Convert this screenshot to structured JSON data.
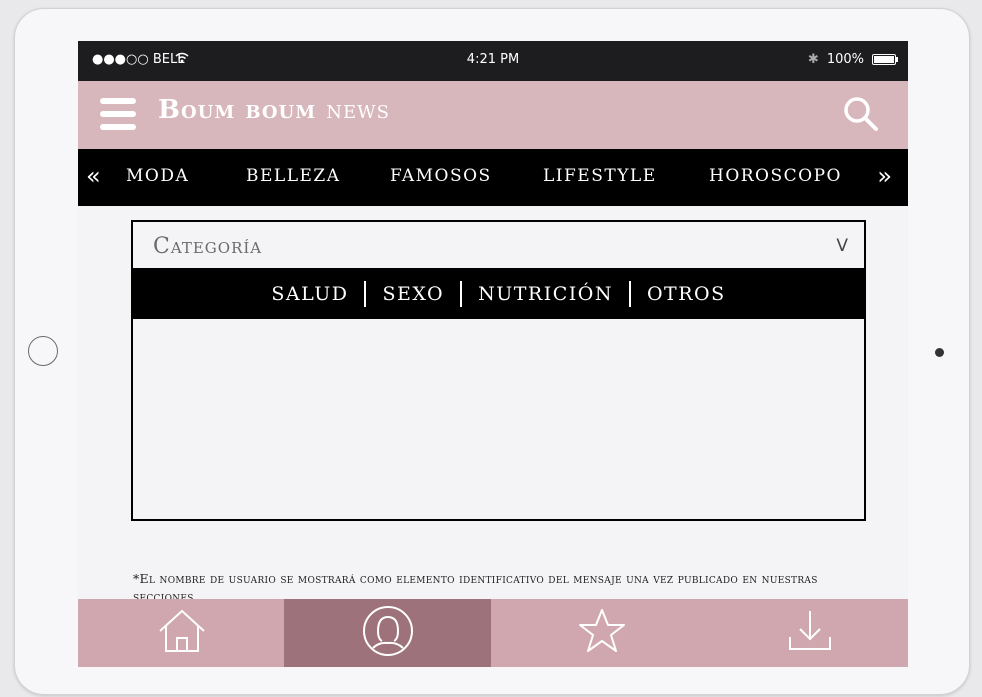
{
  "status_bar": {
    "carrier": "●●●○○ BELL",
    "time": "4:21 PM",
    "battery": "100%"
  },
  "header": {
    "brand_bold": "Boum boum",
    "brand_light": "news"
  },
  "nav": {
    "left_arrow": "«",
    "right_arrow": "»",
    "items": [
      "MODA",
      "BELLEZA",
      "FAMOSOS",
      "LIFESTYLE",
      "HOROSCOPO"
    ]
  },
  "category": {
    "label": "Categoría",
    "caret": "V",
    "options": [
      "SALUD",
      "SEXO",
      "NUTRICIÓN",
      "OTROS"
    ]
  },
  "footnote": "*El nombre de usuario se mostrará como elemento identificativo del mensaje una vez publicado en nuestras secciones",
  "tabbar": {
    "tabs": [
      "home",
      "profile",
      "favorites",
      "download"
    ],
    "active": "profile"
  },
  "colors": {
    "header": "#d7b6bc",
    "nav": "#000000",
    "tabbar": "#d0a7ae",
    "tab_active": "#9e727b"
  }
}
